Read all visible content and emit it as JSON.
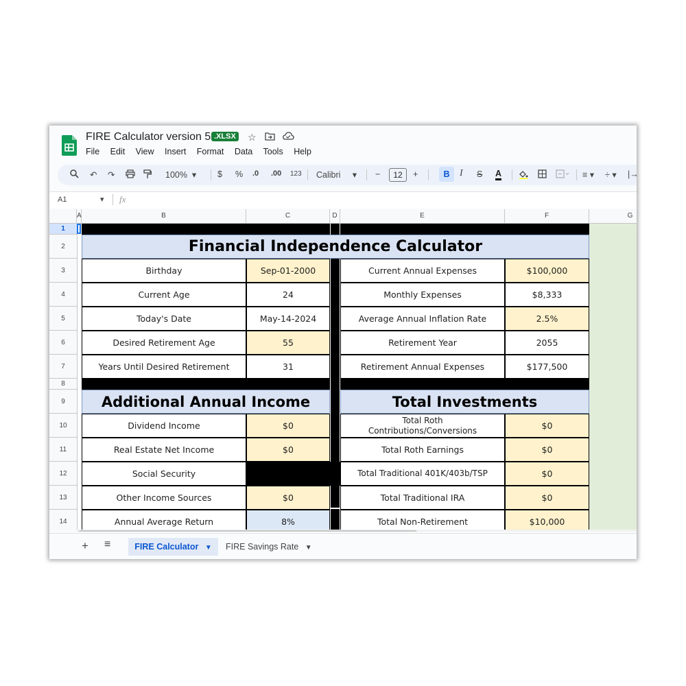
{
  "window": {
    "title": "FIRE Calculator version 5",
    "badge": ".XLSX",
    "menu": [
      "File",
      "Edit",
      "View",
      "Insert",
      "Format",
      "Data",
      "Tools",
      "Help"
    ]
  },
  "toolbar": {
    "zoom": "100%",
    "currency": "$",
    "percent": "%",
    "decimal_decrease": ".0",
    "decimal_increase": ".00",
    "number_format": "123",
    "font": "Calibri",
    "font_size": "12",
    "bold": "B",
    "italic": "I",
    "text_color": "A"
  },
  "formula_bar": {
    "cell_ref": "A1",
    "fx": "fx"
  },
  "columns": [
    "A",
    "B",
    "C",
    "D",
    "E",
    "F",
    "G"
  ],
  "rows": [
    "1",
    "2",
    "3",
    "4",
    "5",
    "6",
    "7",
    "8",
    "9",
    "10",
    "11",
    "12",
    "13",
    "14"
  ],
  "sheet": {
    "main_title": "Financial Independence Calculator",
    "left_table": [
      {
        "label": "Birthday",
        "value": "Sep-01-2000",
        "input": true
      },
      {
        "label": "Current Age",
        "value": "24",
        "input": false
      },
      {
        "label": "Today's Date",
        "value": "May-14-2024",
        "input": false
      },
      {
        "label": "Desired Retirement Age",
        "value": "55",
        "input": true
      },
      {
        "label": "Years Until Desired Retirement",
        "value": "31",
        "input": false
      }
    ],
    "right_table": [
      {
        "label": "Current Annual Expenses",
        "value": "$100,000",
        "input": true
      },
      {
        "label": "Monthly Expenses",
        "value": "$8,333",
        "input": false
      },
      {
        "label": "Average Annual Inflation Rate",
        "value": "2.5%",
        "input": true
      },
      {
        "label": "Retirement Year",
        "value": "2055",
        "input": false
      },
      {
        "label": "Retirement Annual Expenses",
        "value": "$177,500",
        "input": false
      }
    ],
    "income_title": "Additional Annual Income",
    "income_rows": [
      {
        "label": "Dividend Income",
        "value": "$0"
      },
      {
        "label": "Real Estate Net Income",
        "value": "$0"
      },
      {
        "label": "Social Security",
        "value": ""
      },
      {
        "label": "Other Income Sources",
        "value": "$0"
      },
      {
        "label": "Annual Average Return",
        "value": "8%"
      }
    ],
    "investments_title": "Total Investments",
    "investment_rows": [
      {
        "label": "Total Roth Contributions/Conversions",
        "value": "$0"
      },
      {
        "label": "Total Roth Earnings",
        "value": "$0"
      },
      {
        "label": "Total Traditional 401K/403b/TSP",
        "value": "$0"
      },
      {
        "label": "Total Traditional IRA",
        "value": "$0"
      },
      {
        "label": "Total Non-Retirement",
        "value": "$10,000"
      }
    ]
  },
  "tabs": [
    {
      "label": "FIRE Calculator",
      "active": true
    },
    {
      "label": "FIRE Savings Rate",
      "active": false
    }
  ],
  "colors": {
    "input_fill": "#fff2cc",
    "header_fill": "#dae3f3",
    "return_fill": "#dce8f5",
    "column_g_fill": "#e2edd9",
    "brand": "#188038"
  }
}
